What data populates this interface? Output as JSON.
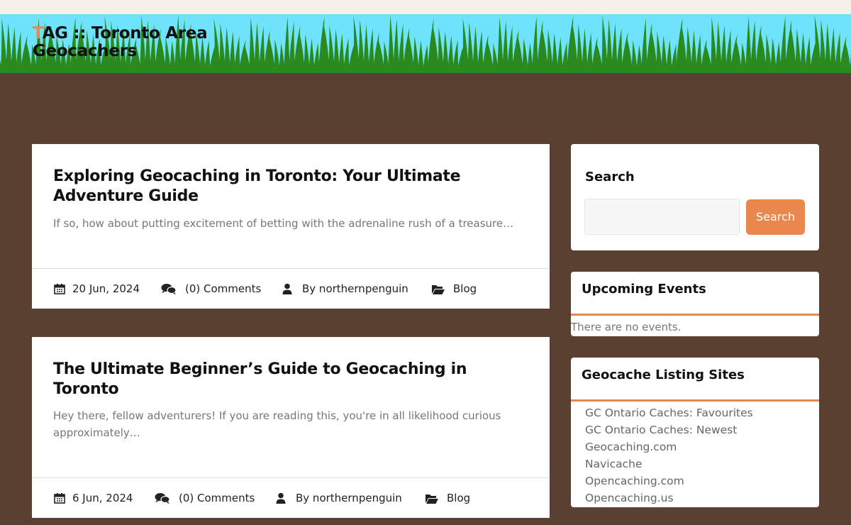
{
  "site": {
    "title_first_letter": "T",
    "title_rest": "AG :: Toronto Area Geocachers"
  },
  "posts": [
    {
      "title": "Exploring Geocaching in Toronto: Your Ultimate Adventure Guide",
      "excerpt": "If so, how about putting excitement of betting with the adrenaline rush of a treasure…",
      "date": "20 Jun, 2024",
      "comments": "(0) Comments",
      "author": "By northernpenguin",
      "category": "Blog"
    },
    {
      "title": "The Ultimate Beginner’s Guide to Geocaching in Toronto",
      "excerpt": "Hey there, fellow adventurers! If you are reading this, you're in all likelihood curious approximately…",
      "date": "6 Jun, 2024",
      "comments": "(0) Comments",
      "author": "By northernpenguin",
      "category": "Blog"
    }
  ],
  "sidebar": {
    "search": {
      "title": "Search",
      "button": "Search",
      "placeholder": ""
    },
    "events": {
      "title": "Upcoming Events",
      "empty": "There are no events."
    },
    "links": {
      "title": "Geocache Listing Sites",
      "items": [
        "GC Ontario Caches: Favourites",
        "GC Ontario Caches: Newest",
        "Geocaching.com",
        "Navicache",
        "Opencaching.com",
        "Opencaching.us"
      ]
    }
  },
  "colors": {
    "accent": "#e8884f",
    "background": "#5a4030",
    "sky": "#6fe3fb",
    "grass": "#2a8a1d"
  },
  "icons": [
    "calendar-icon",
    "comments-icon",
    "user-icon",
    "folder-open-icon"
  ]
}
